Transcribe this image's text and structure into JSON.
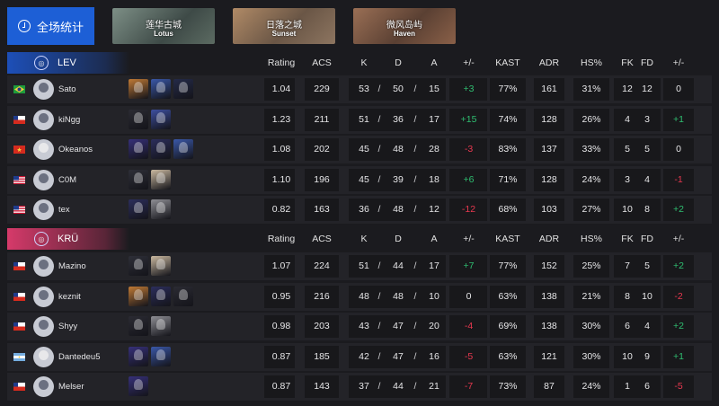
{
  "header": {
    "all_stats_label": "全场统计",
    "maps": [
      {
        "zh": "莲华古城",
        "en": "Lotus",
        "color": "#5a6b6a"
      },
      {
        "zh": "日落之城",
        "en": "Sunset",
        "color": "#8a6a55"
      },
      {
        "zh": "微风岛屿",
        "en": "Haven",
        "color": "#7a5a48"
      }
    ]
  },
  "columns": [
    "Rating",
    "ACS",
    "K",
    "D",
    "A",
    "+/-",
    "KAST",
    "ADR",
    "HS%",
    "FK",
    "FD",
    "+/-"
  ],
  "teams": [
    {
      "name": "LEV",
      "accent": "#1d4fb8",
      "players": [
        {
          "flag": "br",
          "name": "Sato",
          "agents": [
            "#c07a35",
            "#3a58a8",
            "#242a48"
          ],
          "rating": "1.04",
          "acs": "229",
          "k": "53",
          "d": "50",
          "a": "15",
          "pm": "+3",
          "pm_sign": "pos",
          "kast": "77%",
          "adr": "161",
          "hs": "31%",
          "fk": "12",
          "fd": "12",
          "fpm": "0",
          "fpm_sign": ""
        },
        {
          "flag": "cl",
          "name": "kiNgg",
          "agents": [
            "#2b2b33",
            "#3d4fa0"
          ],
          "rating": "1.23",
          "acs": "211",
          "k": "51",
          "d": "36",
          "a": "17",
          "pm": "+15",
          "pm_sign": "pos",
          "kast": "74%",
          "adr": "128",
          "hs": "26%",
          "fk": "4",
          "fd": "3",
          "fpm": "+1",
          "fpm_sign": "pos"
        },
        {
          "flag": "vn",
          "name": "Okeanos",
          "agents": [
            "#36307a",
            "#2c2e5c",
            "#3a58a8"
          ],
          "rating": "1.08",
          "acs": "202",
          "k": "45",
          "d": "48",
          "a": "28",
          "pm": "-3",
          "pm_sign": "neg",
          "kast": "83%",
          "adr": "137",
          "hs": "33%",
          "fk": "5",
          "fd": "5",
          "fpm": "0",
          "fpm_sign": ""
        },
        {
          "flag": "us",
          "name": "C0M",
          "agents": [
            "#2e2f38",
            "#cbb9a0"
          ],
          "rating": "1.10",
          "acs": "196",
          "k": "45",
          "d": "39",
          "a": "18",
          "pm": "+6",
          "pm_sign": "pos",
          "kast": "71%",
          "adr": "128",
          "hs": "24%",
          "fk": "3",
          "fd": "4",
          "fpm": "-1",
          "fpm_sign": "neg"
        },
        {
          "flag": "us",
          "name": "tex",
          "agents": [
            "#2c2e5c",
            "#8f8f95"
          ],
          "rating": "0.82",
          "acs": "163",
          "k": "36",
          "d": "48",
          "a": "12",
          "pm": "-12",
          "pm_sign": "neg",
          "kast": "68%",
          "adr": "103",
          "hs": "27%",
          "fk": "10",
          "fd": "8",
          "fpm": "+2",
          "fpm_sign": "pos"
        }
      ]
    },
    {
      "name": "KRÜ",
      "accent": "#d63a6a",
      "players": [
        {
          "flag": "cl",
          "name": "Mazino",
          "agents": [
            "#2e2f38",
            "#cbb9a0"
          ],
          "rating": "1.07",
          "acs": "224",
          "k": "51",
          "d": "44",
          "a": "17",
          "pm": "+7",
          "pm_sign": "pos",
          "kast": "77%",
          "adr": "152",
          "hs": "25%",
          "fk": "7",
          "fd": "5",
          "fpm": "+2",
          "fpm_sign": "pos"
        },
        {
          "flag": "cl",
          "name": "keznit",
          "agents": [
            "#c07a35",
            "#2c2e5c",
            "#2b2b33"
          ],
          "rating": "0.95",
          "acs": "216",
          "k": "48",
          "d": "48",
          "a": "10",
          "pm": "0",
          "pm_sign": "",
          "kast": "63%",
          "adr": "138",
          "hs": "21%",
          "fk": "8",
          "fd": "10",
          "fpm": "-2",
          "fpm_sign": "neg"
        },
        {
          "flag": "cl",
          "name": "Shyy",
          "agents": [
            "#2b2b33",
            "#8f8f95"
          ],
          "rating": "0.98",
          "acs": "203",
          "k": "43",
          "d": "47",
          "a": "20",
          "pm": "-4",
          "pm_sign": "neg",
          "kast": "69%",
          "adr": "138",
          "hs": "30%",
          "fk": "6",
          "fd": "4",
          "fpm": "+2",
          "fpm_sign": "pos"
        },
        {
          "flag": "ar",
          "name": "Dantedeu5",
          "agents": [
            "#36307a",
            "#3a58a8"
          ],
          "rating": "0.87",
          "acs": "185",
          "k": "42",
          "d": "47",
          "a": "16",
          "pm": "-5",
          "pm_sign": "neg",
          "kast": "63%",
          "adr": "121",
          "hs": "30%",
          "fk": "10",
          "fd": "9",
          "fpm": "+1",
          "fpm_sign": "pos"
        },
        {
          "flag": "cl",
          "name": "Melser",
          "agents": [
            "#36307a"
          ],
          "rating": "0.87",
          "acs": "143",
          "k": "37",
          "d": "44",
          "a": "21",
          "pm": "-7",
          "pm_sign": "neg",
          "kast": "73%",
          "adr": "87",
          "hs": "24%",
          "fk": "1",
          "fd": "6",
          "fpm": "-5",
          "fpm_sign": "neg"
        }
      ]
    }
  ]
}
